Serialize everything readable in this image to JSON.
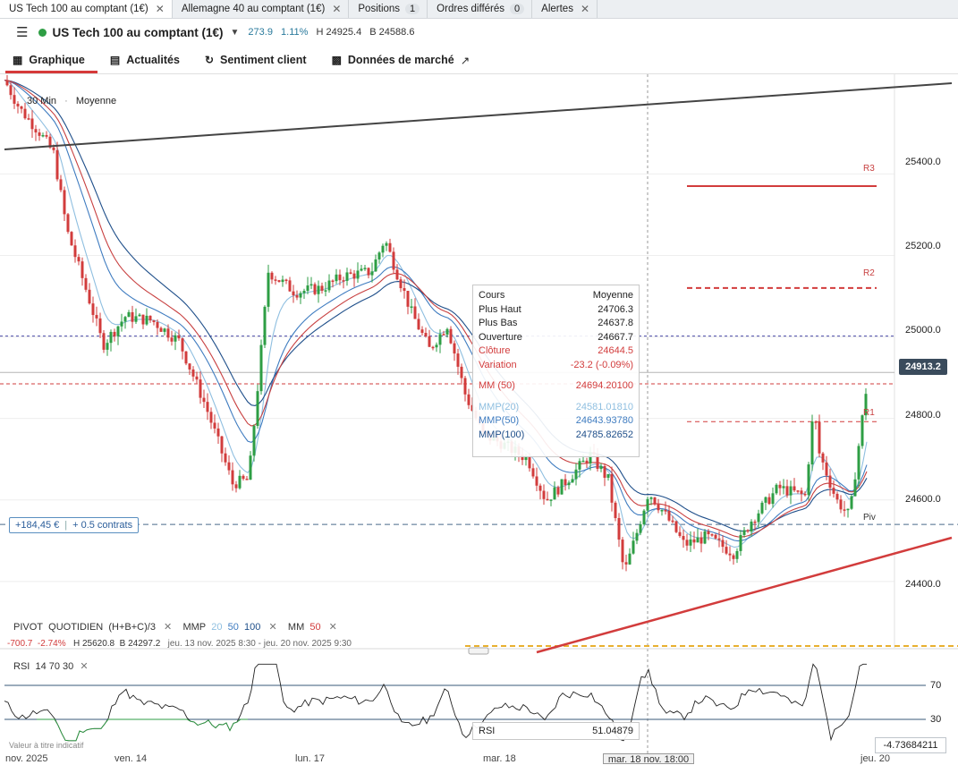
{
  "tabs": [
    {
      "label": "US Tech 100 au comptant (1€)",
      "active": true,
      "close": "✕"
    },
    {
      "label": "Allemagne 40 au comptant (1€)",
      "active": false,
      "close": "✕"
    },
    {
      "label": "Positions",
      "count": "1"
    },
    {
      "label": "Ordres différés",
      "count": "0"
    },
    {
      "label": "Alertes",
      "close": "✕"
    }
  ],
  "instrument": {
    "name": "US Tech 100 au comptant (1€)",
    "change": "273.9",
    "change_pct": "1.11%",
    "high": "H 24925.4",
    "low": "B 24588.6",
    "status_color": "#2e9e44"
  },
  "nav": [
    {
      "label": "Graphique",
      "icon": "chart-icon",
      "active": true
    },
    {
      "label": "Actualités",
      "icon": "newspaper-icon"
    },
    {
      "label": "Sentiment client",
      "icon": "refresh-icon"
    },
    {
      "label": "Données de marché",
      "icon": "clipboard-icon",
      "ext": "↗"
    }
  ],
  "chart": {
    "timeframe": "30 Min",
    "mode": "Moyenne",
    "current_price": "24913.2",
    "position": {
      "pnl": "+184,45 €",
      "size": "+ 0.5 contrats"
    },
    "pivot_labels": [
      "R3",
      "R2",
      "R1",
      "Piv"
    ],
    "tooltip": {
      "header": {
        "label": "Cours",
        "value": "Moyenne"
      },
      "rows": [
        {
          "label": "Plus Haut",
          "value": "24706.3"
        },
        {
          "label": "Plus Bas",
          "value": "24637.8"
        },
        {
          "label": "Ouverture",
          "value": "24667.7"
        },
        {
          "label": "Clôture",
          "value": "24644.5"
        },
        {
          "label": "Variation",
          "value": "-23.2 (-0.09%)"
        }
      ],
      "mm": {
        "label": "MM (50)",
        "value": "24694.20100"
      },
      "mmp": [
        {
          "label": "MMP(20)",
          "value": "24581.01810"
        },
        {
          "label": "MMP(50)",
          "value": "24643.93780"
        },
        {
          "label": "MMP(100)",
          "value": "24785.82652"
        }
      ]
    },
    "indicators": {
      "pivot": "PIVOT",
      "pivot_period": "QUOTIDIEN",
      "pivot_formula": "(H+B+C)/3",
      "mmp": "MMP",
      "mmp_periods": [
        "20",
        "50",
        "100"
      ],
      "mm": "MM",
      "mm_period": "50",
      "close": "✕"
    },
    "range_info": {
      "change": "-700.7",
      "change_pct": "-2.74%",
      "high": "H 25620.8",
      "low": "B 24297.2",
      "period": "jeu. 13 nov. 2025 8:30 - jeu. 20 nov. 2025 9:30"
    },
    "rsi": {
      "label": "RSI",
      "params": "14 70 30",
      "close": "✕",
      "value": "51.04879",
      "axis_value": "-4.73684211",
      "levels": [
        "70",
        "30"
      ],
      "value_label": "Valeur à titre indicatif"
    },
    "x_labels": [
      "nov. 2025",
      "ven. 14",
      "lun. 17",
      "mar. 18",
      "jeu. 20"
    ],
    "x_hover": "mar. 18 nov. 18:00"
  },
  "chart_data": {
    "type": "candlestick",
    "y_ticks": [
      "25400.0",
      "25200.0",
      "25000.0",
      "24800.0",
      "24600.0",
      "24400.0"
    ],
    "ylim": [
      24290,
      25640
    ],
    "colors": {
      "up": "#2e9e44",
      "down": "#d23c3c",
      "mmp20": "#8fbfe0",
      "mmp50": "#3f7cc0",
      "mmp100": "#1f4f8a",
      "mm50": "#c84040"
    }
  }
}
